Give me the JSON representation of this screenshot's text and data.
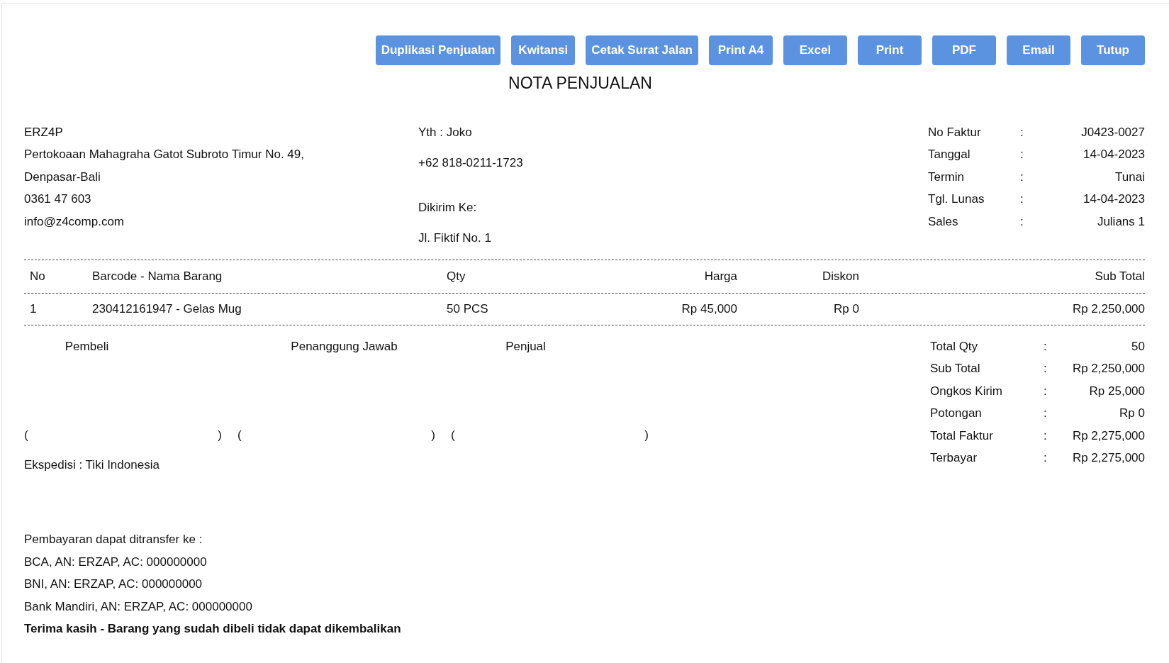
{
  "buttons": [
    "Duplikasi Penjualan",
    "Kwitansi",
    "Cetak Surat Jalan",
    "Print A4",
    "Excel",
    "Print",
    "PDF",
    "Email",
    "Tutup"
  ],
  "title": "NOTA PENJUALAN",
  "seller": {
    "name": "ERZ4P",
    "address": "Pertokoaan Mahagraha Gatot Subroto Timur No. 49,",
    "city": "Denpasar-Bali",
    "phone": "0361 47 603",
    "email": "info@z4comp.com"
  },
  "customer": {
    "label": "Yth :",
    "name": "Joko",
    "phone": "+62 818-0211-1723",
    "ship_label": "Dikirim Ke:",
    "ship_address": "Jl. Fiktif No. 1"
  },
  "invoice_info": [
    {
      "label": "No Faktur",
      "sep": ":",
      "value": "J0423-0027"
    },
    {
      "label": "Tanggal",
      "sep": ":",
      "value": "14-04-2023"
    },
    {
      "label": "Termin",
      "sep": ":",
      "value": "Tunai"
    },
    {
      "label": "Tgl. Lunas",
      "sep": ":",
      "value": "14-04-2023"
    },
    {
      "label": "Sales",
      "sep": ":",
      "value": "Julians 1"
    }
  ],
  "table": {
    "columns": [
      "No",
      "Barcode - Nama Barang",
      "Qty",
      "Harga",
      "Diskon",
      "Sub Total"
    ],
    "rows": [
      [
        "1",
        "230412161947 - Gelas Mug",
        "50 PCS",
        "Rp 45,000",
        "Rp 0",
        "Rp 2,250,000"
      ]
    ]
  },
  "signatures": [
    {
      "label": "Pembeli",
      "open": "(",
      "close": ")"
    },
    {
      "label": "Penanggung Jawab",
      "open": "(",
      "close": ")"
    },
    {
      "label": "Penjual",
      "open": "(",
      "close": ")"
    }
  ],
  "expedition": "Ekspedisi : Tiki Indonesia",
  "totals": [
    {
      "label": "Total Qty",
      "sep": ":",
      "value": "50"
    },
    {
      "label": "Sub Total",
      "sep": ":",
      "value": "Rp 2,250,000"
    },
    {
      "label": "Ongkos Kirim",
      "sep": ":",
      "value": "Rp 25,000"
    },
    {
      "label": "Potongan",
      "sep": ":",
      "value": "Rp 0"
    },
    {
      "label": "Total Faktur",
      "sep": ":",
      "value": "Rp 2,275,000"
    },
    {
      "label": "Terbayar",
      "sep": ":",
      "value": "Rp 2,275,000"
    }
  ],
  "payment_lines": [
    "Pembayaran dapat ditransfer ke :",
    "BCA, AN: ERZAP, AC: 000000000",
    "BNI, AN: ERZAP, AC: 000000000",
    "Bank Mandiri, AN: ERZAP, AC: 000000000"
  ],
  "footer_note": "Terima kasih - Barang yang sudah dibeli tidak dapat dikembalikan"
}
